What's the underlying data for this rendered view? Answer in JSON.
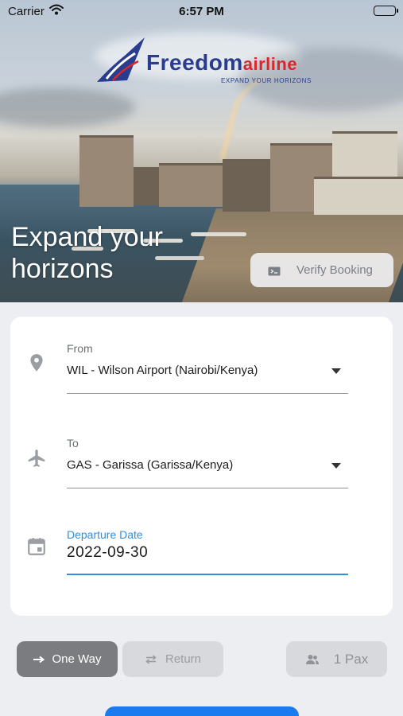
{
  "status_bar": {
    "carrier": "Carrier",
    "time": "6:57 PM"
  },
  "logo": {
    "word_primary": "Freedom",
    "word_secondary": "airline",
    "tagline": "EXPAND YOUR HORIZONS"
  },
  "hero": {
    "title": "Expand your horizons",
    "verify_booking_label": "Verify Booking"
  },
  "form": {
    "from": {
      "label": "From",
      "value": "WIL - Wilson Airport (Nairobi/Kenya)"
    },
    "to": {
      "label": "To",
      "value": "GAS - Garissa (Garissa/Kenya)"
    },
    "departure": {
      "label": "Departure Date",
      "value": "2022-09-30"
    }
  },
  "trip": {
    "one_way_label": "One Way",
    "return_label": "Return",
    "selected": "One Way",
    "pax_label": "1 Pax"
  },
  "colors": {
    "accent": "#2f8fe0",
    "primary_button": "#1a7bef",
    "brand_blue": "#2a3c8e",
    "brand_red": "#d9262b",
    "selected_pill": "#7a7c80"
  },
  "icons": [
    "wifi-icon",
    "battery-icon",
    "ticket-icon",
    "location-pin-icon",
    "airplane-icon",
    "calendar-icon",
    "arrow-right-icon",
    "swap-arrows-icon",
    "people-icon"
  ]
}
